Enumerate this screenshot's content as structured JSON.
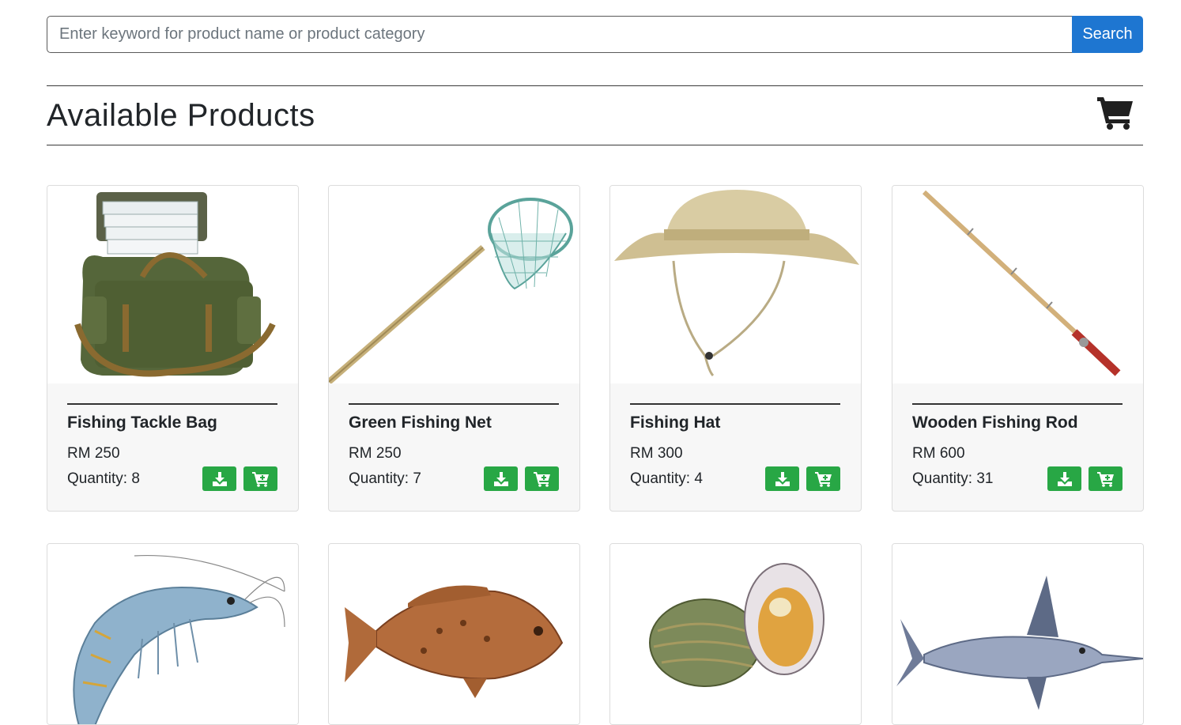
{
  "search": {
    "placeholder": "Enter keyword for product name or product category",
    "button_label": "Search"
  },
  "header": {
    "title": "Available Products",
    "cart_icon": "shopping-cart-icon"
  },
  "labels": {
    "quantity_prefix": "Quantity: "
  },
  "products": [
    {
      "name": "Fishing Tackle Bag",
      "price": "RM 250",
      "quantity": "8",
      "image": "tackle-bag"
    },
    {
      "name": "Green Fishing Net",
      "price": "RM 250",
      "quantity": "7",
      "image": "fishing-net"
    },
    {
      "name": "Fishing Hat",
      "price": "RM 300",
      "quantity": "4",
      "image": "fishing-hat"
    },
    {
      "name": "Wooden Fishing Rod",
      "price": "RM 600",
      "quantity": "31",
      "image": "fishing-rod"
    },
    {
      "name": "",
      "price": "",
      "quantity": "",
      "image": "prawn"
    },
    {
      "name": "",
      "price": "",
      "quantity": "",
      "image": "grouper-fish"
    },
    {
      "name": "",
      "price": "",
      "quantity": "",
      "image": "oyster"
    },
    {
      "name": "",
      "price": "",
      "quantity": "",
      "image": "swordfish"
    }
  ],
  "colors": {
    "primary": "#1e76d1",
    "success": "#28a745",
    "text": "#212529"
  }
}
